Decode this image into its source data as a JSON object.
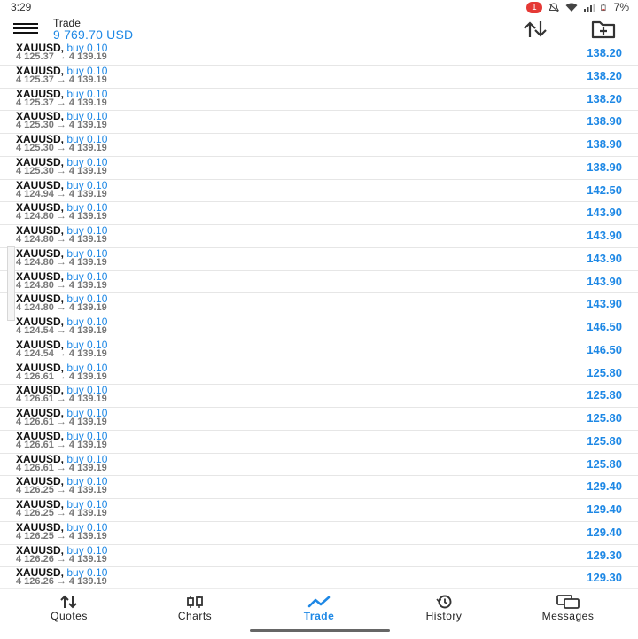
{
  "status_bar": {
    "time": "3:29",
    "notification_count": "1",
    "battery": "7%"
  },
  "header": {
    "title": "Trade",
    "balance": "9 769.70 USD"
  },
  "positions": [
    {
      "symbol": "XAUUSD,",
      "direction": "buy 0.10",
      "prices": "4 125.37 → 4 139.19",
      "profit": "138.20"
    },
    {
      "symbol": "XAUUSD,",
      "direction": "buy 0.10",
      "prices": "4 125.37 → 4 139.19",
      "profit": "138.20"
    },
    {
      "symbol": "XAUUSD,",
      "direction": "buy 0.10",
      "prices": "4 125.37 → 4 139.19",
      "profit": "138.20"
    },
    {
      "symbol": "XAUUSD,",
      "direction": "buy 0.10",
      "prices": "4 125.30 → 4 139.19",
      "profit": "138.90"
    },
    {
      "symbol": "XAUUSD,",
      "direction": "buy 0.10",
      "prices": "4 125.30 → 4 139.19",
      "profit": "138.90"
    },
    {
      "symbol": "XAUUSD,",
      "direction": "buy 0.10",
      "prices": "4 125.30 → 4 139.19",
      "profit": "138.90"
    },
    {
      "symbol": "XAUUSD,",
      "direction": "buy 0.10",
      "prices": "4 124.94 → 4 139.19",
      "profit": "142.50"
    },
    {
      "symbol": "XAUUSD,",
      "direction": "buy 0.10",
      "prices": "4 124.80 → 4 139.19",
      "profit": "143.90"
    },
    {
      "symbol": "XAUUSD,",
      "direction": "buy 0.10",
      "prices": "4 124.80 → 4 139.19",
      "profit": "143.90"
    },
    {
      "symbol": "XAUUSD,",
      "direction": "buy 0.10",
      "prices": "4 124.80 → 4 139.19",
      "profit": "143.90"
    },
    {
      "symbol": "XAUUSD,",
      "direction": "buy 0.10",
      "prices": "4 124.80 → 4 139.19",
      "profit": "143.90"
    },
    {
      "symbol": "XAUUSD,",
      "direction": "buy 0.10",
      "prices": "4 124.80 → 4 139.19",
      "profit": "143.90"
    },
    {
      "symbol": "XAUUSD,",
      "direction": "buy 0.10",
      "prices": "4 124.54 → 4 139.19",
      "profit": "146.50"
    },
    {
      "symbol": "XAUUSD,",
      "direction": "buy 0.10",
      "prices": "4 124.54 → 4 139.19",
      "profit": "146.50"
    },
    {
      "symbol": "XAUUSD,",
      "direction": "buy 0.10",
      "prices": "4 126.61 → 4 139.19",
      "profit": "125.80"
    },
    {
      "symbol": "XAUUSD,",
      "direction": "buy 0.10",
      "prices": "4 126.61 → 4 139.19",
      "profit": "125.80"
    },
    {
      "symbol": "XAUUSD,",
      "direction": "buy 0.10",
      "prices": "4 126.61 → 4 139.19",
      "profit": "125.80"
    },
    {
      "symbol": "XAUUSD,",
      "direction": "buy 0.10",
      "prices": "4 126.61 → 4 139.19",
      "profit": "125.80"
    },
    {
      "symbol": "XAUUSD,",
      "direction": "buy 0.10",
      "prices": "4 126.61 → 4 139.19",
      "profit": "125.80"
    },
    {
      "symbol": "XAUUSD,",
      "direction": "buy 0.10",
      "prices": "4 126.25 → 4 139.19",
      "profit": "129.40"
    },
    {
      "symbol": "XAUUSD,",
      "direction": "buy 0.10",
      "prices": "4 126.25 → 4 139.19",
      "profit": "129.40"
    },
    {
      "symbol": "XAUUSD,",
      "direction": "buy 0.10",
      "prices": "4 126.25 → 4 139.19",
      "profit": "129.40"
    },
    {
      "symbol": "XAUUSD,",
      "direction": "buy 0.10",
      "prices": "4 126.26 → 4 139.19",
      "profit": "129.30"
    },
    {
      "symbol": "XAUUSD,",
      "direction": "buy 0.10",
      "prices": "4 126.26 → 4 139.19",
      "profit": "129.30"
    }
  ],
  "nav": {
    "items": [
      {
        "label": "Quotes",
        "icon": "quotes-arrows-icon"
      },
      {
        "label": "Charts",
        "icon": "charts-candles-icon"
      },
      {
        "label": "Trade",
        "icon": "trade-line-icon"
      },
      {
        "label": "History",
        "icon": "history-clock-icon"
      },
      {
        "label": "Messages",
        "icon": "messages-chat-icon"
      }
    ],
    "active": "Trade"
  },
  "colors": {
    "accent": "#1e88e5",
    "badge": "#e53935"
  }
}
